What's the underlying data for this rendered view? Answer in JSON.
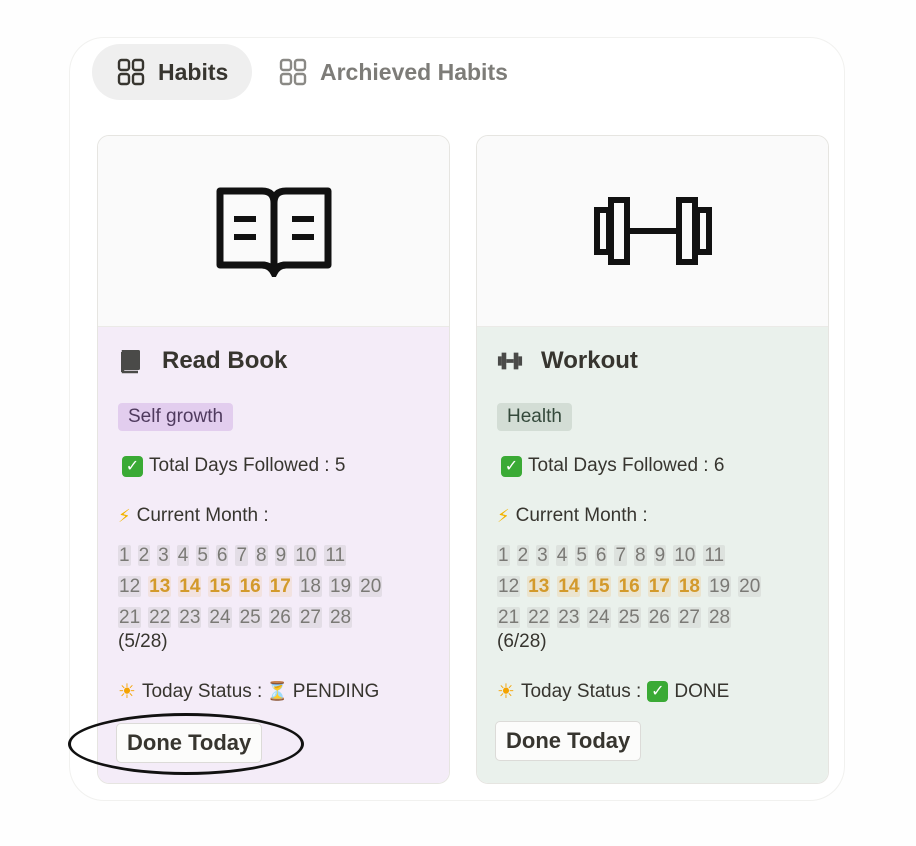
{
  "tabs": [
    {
      "label": "Habits",
      "icon": "gallery-grid-icon",
      "active": true
    },
    {
      "label": "Archieved Habits",
      "icon": "gallery-grid-icon",
      "active": false
    }
  ],
  "cards": [
    {
      "title": "Read Book",
      "title_icon": "book-icon",
      "cover_icon": "open-book-icon",
      "tag": "Self growth",
      "total_days_label": "Total Days Followed : 5",
      "current_month_label": "Current Month :",
      "days_row1": [
        "1",
        "2",
        "3",
        "4",
        "5",
        "6",
        "7",
        "8",
        "9",
        "10",
        "11"
      ],
      "days_row2": [
        "12",
        "13",
        "14",
        "15",
        "16",
        "17",
        "18",
        "19",
        "20"
      ],
      "days_row3": [
        "21",
        "22",
        "23",
        "24",
        "25",
        "26",
        "27",
        "28"
      ],
      "ratio": "(5/28)",
      "status_label": "Today Status :",
      "status_value": "PENDING",
      "button_label": "Done Today",
      "accent": "#f4ecf8"
    },
    {
      "title": "Workout",
      "title_icon": "dumbbell-icon",
      "cover_icon": "dumbbell-icon",
      "tag": "Health",
      "total_days_label": "Total Days Followed : 6",
      "current_month_label": "Current Month :",
      "days_row1": [
        "1",
        "2",
        "3",
        "4",
        "5",
        "6",
        "7",
        "8",
        "9",
        "10",
        "11"
      ],
      "days_row2": [
        "12",
        "13",
        "14",
        "15",
        "16",
        "17",
        "18",
        "19",
        "20"
      ],
      "days_row3": [
        "21",
        "22",
        "23",
        "24",
        "25",
        "26",
        "27",
        "28"
      ],
      "ratio": "(6/28)",
      "status_label": "Today Status :",
      "status_value": "DONE",
      "button_label": "Done Today",
      "accent": "#eaf1ec"
    }
  ],
  "colors": {
    "highlight_day": "#d39a2b",
    "check_green": "#3aaa35"
  }
}
